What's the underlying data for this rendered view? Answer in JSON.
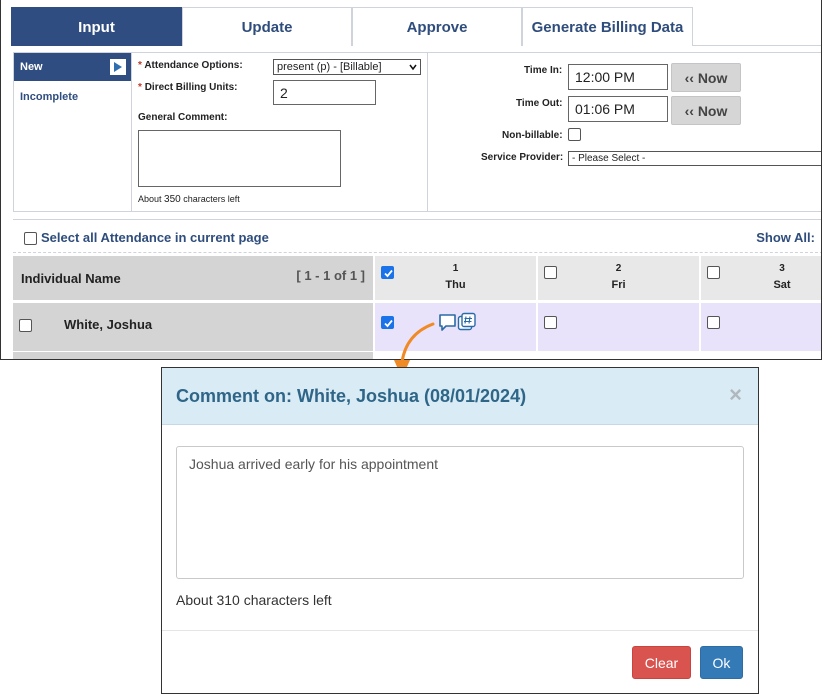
{
  "tabs": [
    "Input",
    "Update",
    "Approve",
    "Generate Billing Data"
  ],
  "sidebar": {
    "new_label": "New",
    "incomplete_label": "Incomplete"
  },
  "form": {
    "attendance_label": "Attendance Options:",
    "attendance_value": "present (p) - [Billable]",
    "billing_units_label": "Direct Billing Units:",
    "billing_units_value": "2",
    "comment_label": "General Comment:",
    "chars_left_prefix": "About ",
    "chars_left_number": "350",
    "chars_left_suffix": " characters left"
  },
  "time": {
    "time_in_label": "Time In:",
    "time_in_value": "12:00 PM",
    "time_out_label": "Time Out:",
    "time_out_value": "01:06 PM",
    "now_label": "‹‹ Now",
    "nonbillable_label": "Non-billable:",
    "provider_label": "Service Provider:",
    "provider_value": "- Please Select -"
  },
  "select_all_label": "Select all Attendance in current page",
  "show_all_label": "Show All:",
  "grid": {
    "name_header": "Individual Name",
    "paging": "[ 1 - 1 of 1 ]",
    "days": [
      {
        "num": "1",
        "dow": "Thu",
        "checked": true
      },
      {
        "num": "2",
        "dow": "Fri",
        "checked": false
      },
      {
        "num": "3",
        "dow": "Sat",
        "checked": false
      }
    ],
    "row": {
      "name": "White, Joshua",
      "cells": [
        {
          "checked": true,
          "has_comment": true
        },
        {
          "checked": false
        },
        {
          "checked": false
        }
      ]
    }
  },
  "icons": [
    "play-arrow-icon",
    "select-caret-icon",
    "check-icon",
    "comment-icon",
    "hash-note-icon",
    "close-icon",
    "callout-arrow-icon"
  ],
  "colors": {
    "nav_blue": "#2f4d80",
    "check_blue": "#1a73e8",
    "modal_header": "#d9ebf5",
    "clear_red": "#d9534f",
    "ok_blue": "#337ab7",
    "arrow_orange": "#f08a24",
    "row_lavender": "#e8e2fb"
  },
  "modal": {
    "title": "Comment on: White, Joshua (08/01/2024)",
    "close": "×",
    "comment_text": "Joshua arrived early for his appointment",
    "chars_left": "About 310 characters left",
    "clear_label": "Clear",
    "ok_label": "Ok"
  }
}
